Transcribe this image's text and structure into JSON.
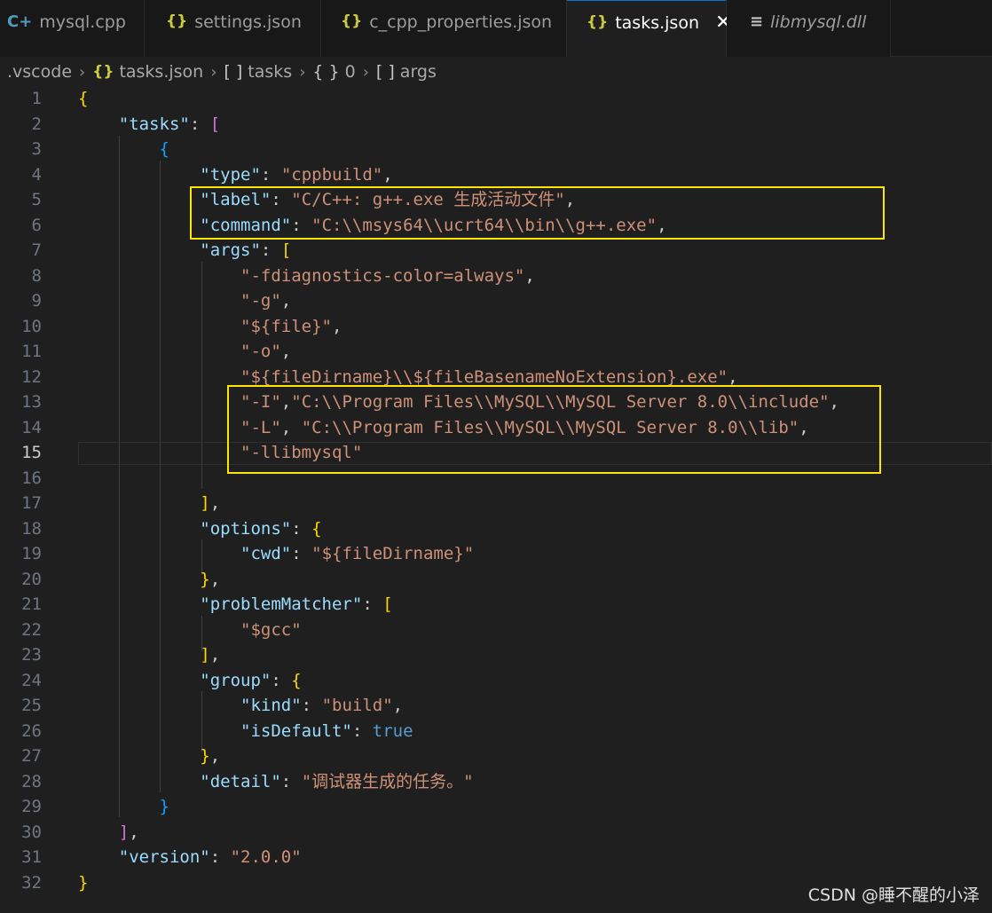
{
  "tabs": [
    {
      "label": "mysql.cpp",
      "icon": "cpp-file-icon",
      "active": false
    },
    {
      "label": "settings.json",
      "icon": "json-braces-icon",
      "active": false
    },
    {
      "label": "c_cpp_properties.json",
      "icon": "json-braces-icon",
      "active": false,
      "modified": true
    },
    {
      "label": "tasks.json",
      "icon": "json-braces-icon",
      "active": true
    },
    {
      "label": "libmysql.dll",
      "icon": "text-file-icon",
      "active": false,
      "italic": true
    }
  ],
  "breadcrumb": {
    "folder": ".vscode",
    "file": "tasks.json",
    "arr1_sym": "[ ]",
    "arr1_label": "tasks",
    "obj_sym": "{ }",
    "obj_label": "0",
    "arr2_sym": "[ ]",
    "arr2_label": "args"
  },
  "editor": {
    "current_line": 15,
    "lines": [
      {
        "n": "1",
        "t": [
          [
            "g1",
            "{"
          ]
        ]
      },
      {
        "n": "2",
        "t": [
          [
            "p",
            "    "
          ],
          [
            "k",
            "\"tasks\""
          ],
          [
            "p",
            ": "
          ],
          [
            "g2",
            "["
          ]
        ]
      },
      {
        "n": "3",
        "t": [
          [
            "p",
            "        "
          ],
          [
            "g3",
            "{"
          ]
        ]
      },
      {
        "n": "4",
        "t": [
          [
            "p",
            "            "
          ],
          [
            "k",
            "\"type\""
          ],
          [
            "p",
            ": "
          ],
          [
            "s",
            "\"cppbuild\""
          ],
          [
            "p",
            ","
          ]
        ]
      },
      {
        "n": "5",
        "t": [
          [
            "p",
            "            "
          ],
          [
            "k",
            "\"label\""
          ],
          [
            "p",
            ": "
          ],
          [
            "s",
            "\"C/C++: g++.exe 生成活动文件\""
          ],
          [
            "p",
            ","
          ]
        ]
      },
      {
        "n": "6",
        "t": [
          [
            "p",
            "            "
          ],
          [
            "k",
            "\"command\""
          ],
          [
            "p",
            ": "
          ],
          [
            "s",
            "\"C:\\\\msys64\\\\ucrt64\\\\bin\\\\g++.exe\""
          ],
          [
            "p",
            ","
          ]
        ]
      },
      {
        "n": "7",
        "t": [
          [
            "p",
            "            "
          ],
          [
            "k",
            "\"args\""
          ],
          [
            "p",
            ": "
          ],
          [
            "g1",
            "["
          ]
        ]
      },
      {
        "n": "8",
        "t": [
          [
            "p",
            "                "
          ],
          [
            "s",
            "\"-fdiagnostics-color=always\""
          ],
          [
            "p",
            ","
          ]
        ]
      },
      {
        "n": "9",
        "t": [
          [
            "p",
            "                "
          ],
          [
            "s",
            "\"-g\""
          ],
          [
            "p",
            ","
          ]
        ]
      },
      {
        "n": "10",
        "t": [
          [
            "p",
            "                "
          ],
          [
            "s",
            "\"${file}\""
          ],
          [
            "p",
            ","
          ]
        ]
      },
      {
        "n": "11",
        "t": [
          [
            "p",
            "                "
          ],
          [
            "s",
            "\"-o\""
          ],
          [
            "p",
            ","
          ]
        ]
      },
      {
        "n": "12",
        "t": [
          [
            "p",
            "                "
          ],
          [
            "s",
            "\"${fileDirname}\\\\${fileBasenameNoExtension}.exe\""
          ],
          [
            "p",
            ","
          ]
        ]
      },
      {
        "n": "13",
        "t": [
          [
            "p",
            "                "
          ],
          [
            "s",
            "\"-I\""
          ],
          [
            "p",
            ","
          ],
          [
            "s",
            "\"C:\\\\Program Files\\\\MySQL\\\\MySQL Server 8.0\\\\include\""
          ],
          [
            "p",
            ","
          ]
        ]
      },
      {
        "n": "14",
        "t": [
          [
            "p",
            "                "
          ],
          [
            "s",
            "\"-L\""
          ],
          [
            "p",
            ", "
          ],
          [
            "s",
            "\"C:\\\\Program Files\\\\MySQL\\\\MySQL Server 8.0\\\\lib\""
          ],
          [
            "p",
            ","
          ]
        ]
      },
      {
        "n": "15",
        "t": [
          [
            "p",
            "                "
          ],
          [
            "s",
            "\"-llibmysql\""
          ]
        ]
      },
      {
        "n": "16",
        "t": []
      },
      {
        "n": "17",
        "t": [
          [
            "p",
            "            "
          ],
          [
            "g1",
            "]"
          ],
          [
            "p",
            ","
          ]
        ]
      },
      {
        "n": "18",
        "t": [
          [
            "p",
            "            "
          ],
          [
            "k",
            "\"options\""
          ],
          [
            "p",
            ": "
          ],
          [
            "g1",
            "{"
          ]
        ]
      },
      {
        "n": "19",
        "t": [
          [
            "p",
            "                "
          ],
          [
            "k",
            "\"cwd\""
          ],
          [
            "p",
            ": "
          ],
          [
            "s",
            "\"${fileDirname}\""
          ]
        ]
      },
      {
        "n": "20",
        "t": [
          [
            "p",
            "            "
          ],
          [
            "g1",
            "}"
          ],
          [
            "p",
            ","
          ]
        ]
      },
      {
        "n": "21",
        "t": [
          [
            "p",
            "            "
          ],
          [
            "k",
            "\"problemMatcher\""
          ],
          [
            "p",
            ": "
          ],
          [
            "g1",
            "["
          ]
        ]
      },
      {
        "n": "22",
        "t": [
          [
            "p",
            "                "
          ],
          [
            "s",
            "\"$gcc\""
          ]
        ]
      },
      {
        "n": "23",
        "t": [
          [
            "p",
            "            "
          ],
          [
            "g1",
            "]"
          ],
          [
            "p",
            ","
          ]
        ]
      },
      {
        "n": "24",
        "t": [
          [
            "p",
            "            "
          ],
          [
            "k",
            "\"group\""
          ],
          [
            "p",
            ": "
          ],
          [
            "g1",
            "{"
          ]
        ]
      },
      {
        "n": "25",
        "t": [
          [
            "p",
            "                "
          ],
          [
            "k",
            "\"kind\""
          ],
          [
            "p",
            ": "
          ],
          [
            "s",
            "\"build\""
          ],
          [
            "p",
            ","
          ]
        ]
      },
      {
        "n": "26",
        "t": [
          [
            "p",
            "                "
          ],
          [
            "k",
            "\"isDefault\""
          ],
          [
            "p",
            ": "
          ],
          [
            "b",
            "true"
          ]
        ]
      },
      {
        "n": "27",
        "t": [
          [
            "p",
            "            "
          ],
          [
            "g1",
            "}"
          ],
          [
            "p",
            ","
          ]
        ]
      },
      {
        "n": "28",
        "t": [
          [
            "p",
            "            "
          ],
          [
            "k",
            "\"detail\""
          ],
          [
            "p",
            ": "
          ],
          [
            "s",
            "\"调试器生成的任务。\""
          ]
        ]
      },
      {
        "n": "29",
        "t": [
          [
            "p",
            "        "
          ],
          [
            "g3",
            "}"
          ]
        ]
      },
      {
        "n": "30",
        "t": [
          [
            "p",
            "    "
          ],
          [
            "g2",
            "]"
          ],
          [
            "p",
            ","
          ]
        ]
      },
      {
        "n": "31",
        "t": [
          [
            "p",
            "    "
          ],
          [
            "k",
            "\"version\""
          ],
          [
            "p",
            ": "
          ],
          [
            "s",
            "\"2.0.0\""
          ]
        ]
      },
      {
        "n": "32",
        "t": [
          [
            "g1",
            "}"
          ]
        ]
      }
    ]
  },
  "watermark": "CSDN @睡不醒的小泽",
  "colors": {
    "background": "#1f1f1f",
    "key": "#9cdcfe",
    "string": "#ce9178",
    "boolean": "#569cd6",
    "highlight_box": "#ffe600"
  }
}
